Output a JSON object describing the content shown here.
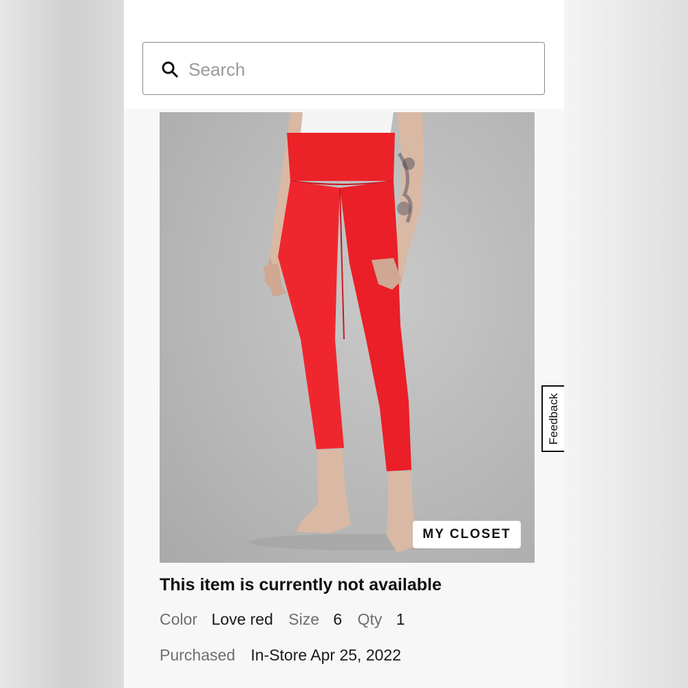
{
  "search": {
    "placeholder": "Search",
    "value": ""
  },
  "product": {
    "image_badge": "MY CLOSET",
    "availability": "This item is currently not available",
    "color_label": "Color",
    "color_value": "Love red",
    "size_label": "Size",
    "size_value": "6",
    "qty_label": "Qty",
    "qty_value": "1",
    "purchased_label": "Purchased",
    "purchased_value": "In-Store Apr 25, 2022"
  },
  "feedback": {
    "label": "Feedback"
  },
  "colors": {
    "product_red": "#f0262e",
    "text": "#111111",
    "muted": "#6e6e6e"
  },
  "icons": [
    "search-icon"
  ]
}
